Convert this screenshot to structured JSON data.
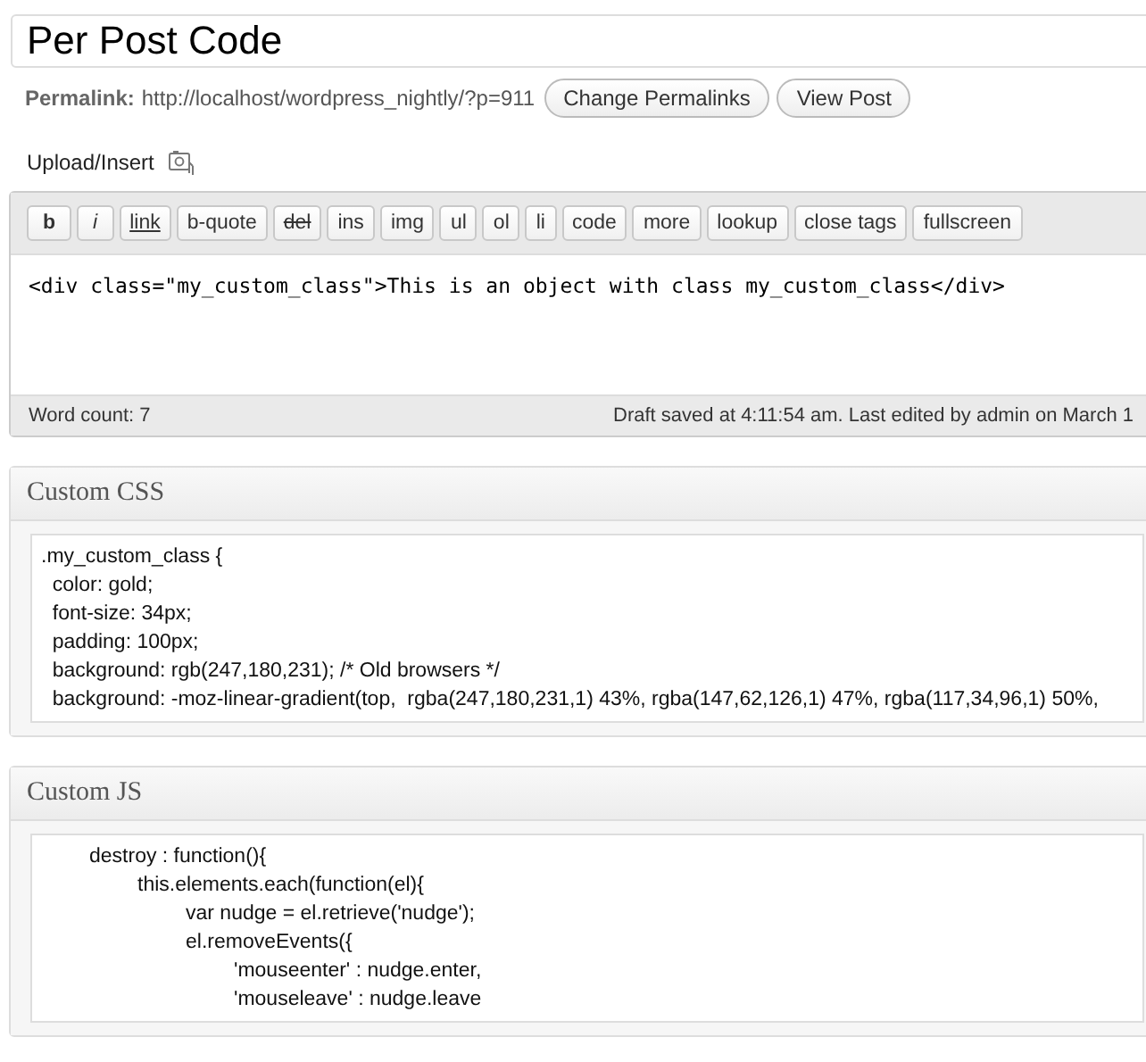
{
  "title_field": {
    "value": "Per Post Code"
  },
  "permalink": {
    "label": "Permalink:",
    "url": "http://localhost/wordpress_nightly/?p=911",
    "buttons": [
      "Change Permalinks",
      "View Post"
    ]
  },
  "upload_insert": {
    "label": "Upload/Insert"
  },
  "toolbar": [
    {
      "label": "b",
      "kind": "bold"
    },
    {
      "label": "i",
      "kind": "italic"
    },
    {
      "label": "link",
      "kind": "underline"
    },
    {
      "label": "b-quote",
      "kind": "plain"
    },
    {
      "label": "del",
      "kind": "strike"
    },
    {
      "label": "ins",
      "kind": "plain"
    },
    {
      "label": "img",
      "kind": "plain"
    },
    {
      "label": "ul",
      "kind": "plain"
    },
    {
      "label": "ol",
      "kind": "plain"
    },
    {
      "label": "li",
      "kind": "plain"
    },
    {
      "label": "code",
      "kind": "plain"
    },
    {
      "label": "more",
      "kind": "plain"
    },
    {
      "label": "lookup",
      "kind": "plain"
    },
    {
      "label": "close tags",
      "kind": "plain"
    },
    {
      "label": "fullscreen",
      "kind": "plain"
    }
  ],
  "editor": {
    "value": "<div class=\"my_custom_class\">This is an object with class my_custom_class</div>"
  },
  "status_bar": {
    "word_count": "Word count: 7",
    "draft": "Draft saved at 4:11:54 am. Last edited by admin on March 1"
  },
  "panels": [
    {
      "title": "Custom CSS",
      "lines": [
        ".my_custom_class {",
        "  color: gold;",
        "  font-size: 34px;",
        "  padding: 100px;",
        "  background: rgb(247,180,231); /* Old browsers */",
        "  background: -moz-linear-gradient(top,  rgba(247,180,231,1) 43%, rgba(147,62,126,1) 47%, rgba(117,34,96,1) 50%,"
      ]
    },
    {
      "title": "Custom JS",
      "lines": [
        "\tdestroy : function(){",
        "\t\tthis.elements.each(function(el){",
        "\t\t\tvar nudge = el.retrieve('nudge');",
        "\t\t\tel.removeEvents({",
        "\t\t\t\t'mouseenter' : nudge.enter,",
        "\t\t\t\t'mouseleave' : nudge.leave"
      ]
    }
  ]
}
